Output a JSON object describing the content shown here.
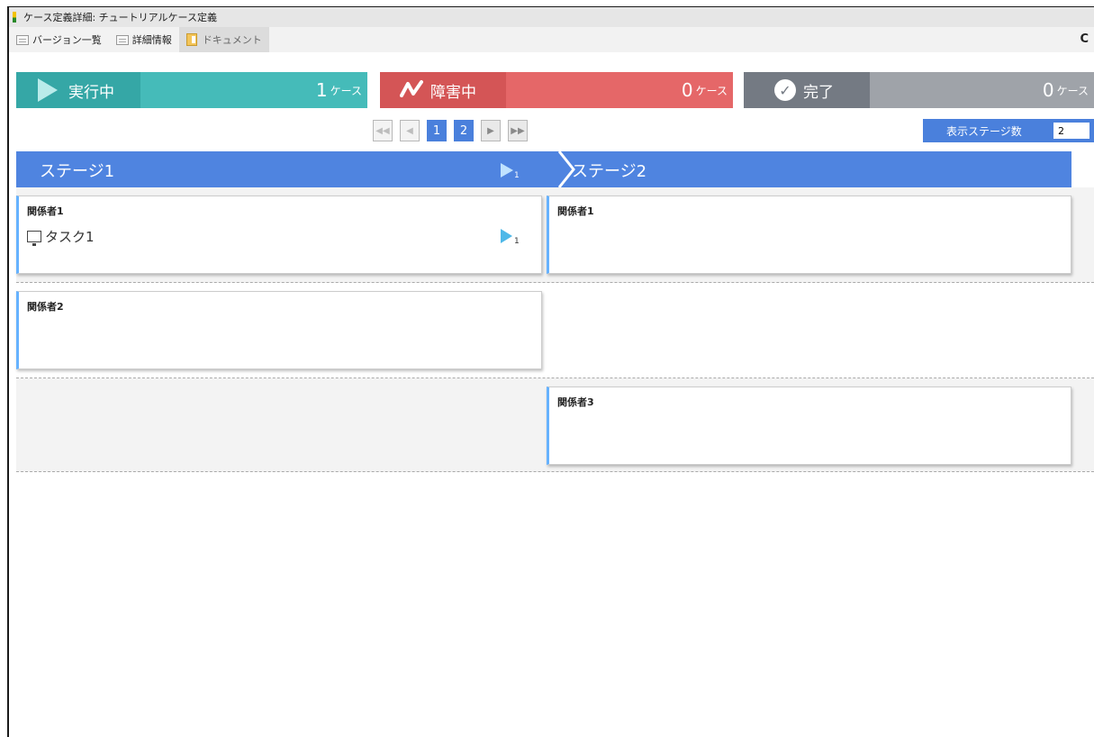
{
  "window": {
    "title": "ケース定義詳細: チュートリアルケース定義"
  },
  "tabs": [
    {
      "label": "バージョン一覧"
    },
    {
      "label": "詳細情報"
    },
    {
      "label": "ドキュメント"
    }
  ],
  "status": {
    "running": {
      "label": "実行中",
      "count": "1",
      "unit": "ケース",
      "color": "#45bbb9"
    },
    "error": {
      "label": "障害中",
      "count": "0",
      "unit": "ケース",
      "color": "#e56768"
    },
    "done": {
      "label": "完了",
      "count": "0",
      "unit": "ケース",
      "color": "#9fa3a9"
    }
  },
  "pager": {
    "pages": [
      "1",
      "2"
    ],
    "current": "1"
  },
  "stage_count": {
    "label": "表示ステージ数",
    "value": "2"
  },
  "stages": [
    {
      "title": "ステージ1",
      "running": "1"
    },
    {
      "title": "ステージ2"
    }
  ],
  "lanes": [
    {
      "stage1": {
        "actor": "関係者1",
        "task": "タスク1",
        "task_running": "1"
      },
      "stage2": {
        "actor": "関係者1"
      }
    },
    {
      "stage1": {
        "actor": "関係者2"
      }
    },
    {
      "stage2": {
        "actor": "関係者3"
      }
    }
  ],
  "accent_color": "#4a80dc"
}
